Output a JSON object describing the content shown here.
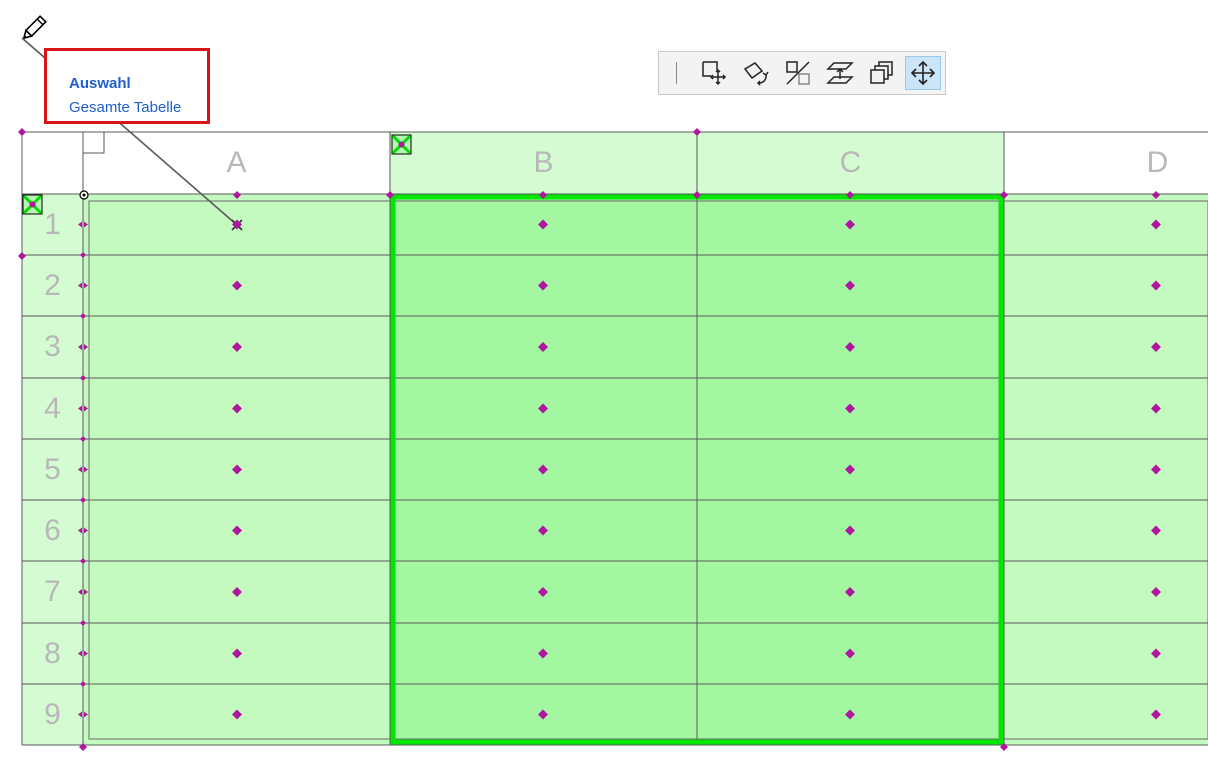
{
  "info": {
    "title": "Auswahl",
    "subtitle": "Gesamte Tabelle"
  },
  "toolbar": {
    "tools": [
      {
        "icon": "move-drag-icon"
      },
      {
        "icon": "rotate-icon"
      },
      {
        "icon": "mirror-icon"
      },
      {
        "icon": "elevate-icon"
      },
      {
        "icon": "multiply-copy-icon"
      },
      {
        "icon": "move-icon",
        "active": true
      }
    ]
  },
  "table": {
    "columns": [
      "A",
      "B",
      "C",
      "D"
    ],
    "rows": [
      "1",
      "2",
      "3",
      "4",
      "5",
      "6",
      "7",
      "8",
      "9"
    ]
  },
  "colors": {
    "accent_text": "#1f5fce",
    "highlight_border": "#d9131a",
    "selection_fill": "#a3f7a0",
    "table_fill": "#c4fac0",
    "header_fill": "#d4fbd2",
    "selection_border": "#00e600",
    "handle": "#b0169f"
  }
}
